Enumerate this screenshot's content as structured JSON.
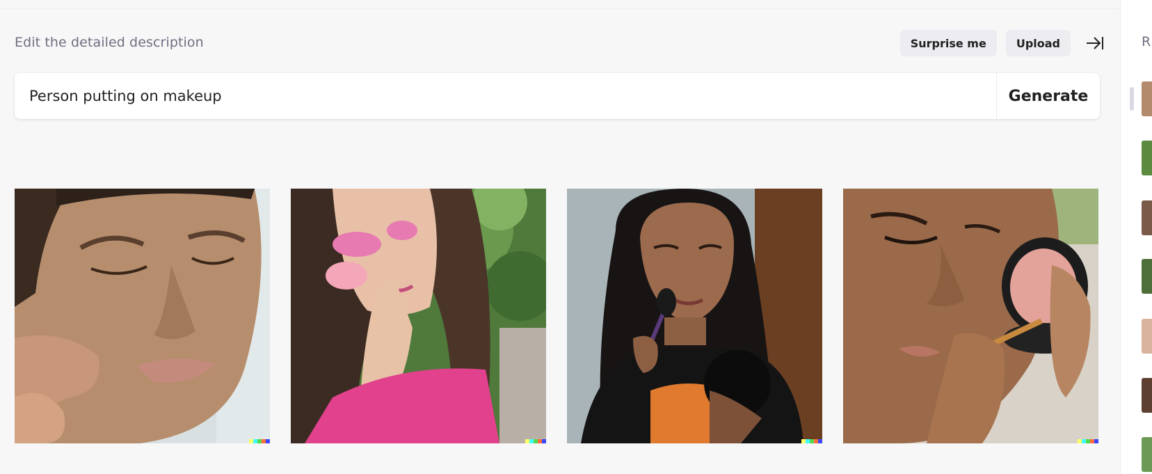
{
  "header": {
    "title": "Edit the detailed description",
    "surprise_label": "Surprise me",
    "upload_label": "Upload"
  },
  "prompt": {
    "value": "Person putting on makeup",
    "generate_label": "Generate"
  },
  "images": [
    {
      "subject": "man with eyes closed touching cheek"
    },
    {
      "subject": "woman with pink eyeshadow touching lips"
    },
    {
      "subject": "woman applying blush with brush and mirror"
    },
    {
      "subject": "girl applying makeup from compact"
    }
  ],
  "sidebar": {
    "title": "R"
  },
  "colors": {
    "accent": "#202123",
    "muted": "#6e6e80",
    "pill_bg": "#ececf1",
    "signature": [
      "#ffff66",
      "#42ffff",
      "#51da4c",
      "#ff6e3c",
      "#3c46ff"
    ]
  },
  "icons": {
    "collapse": "arrow-right-to-line-icon"
  }
}
